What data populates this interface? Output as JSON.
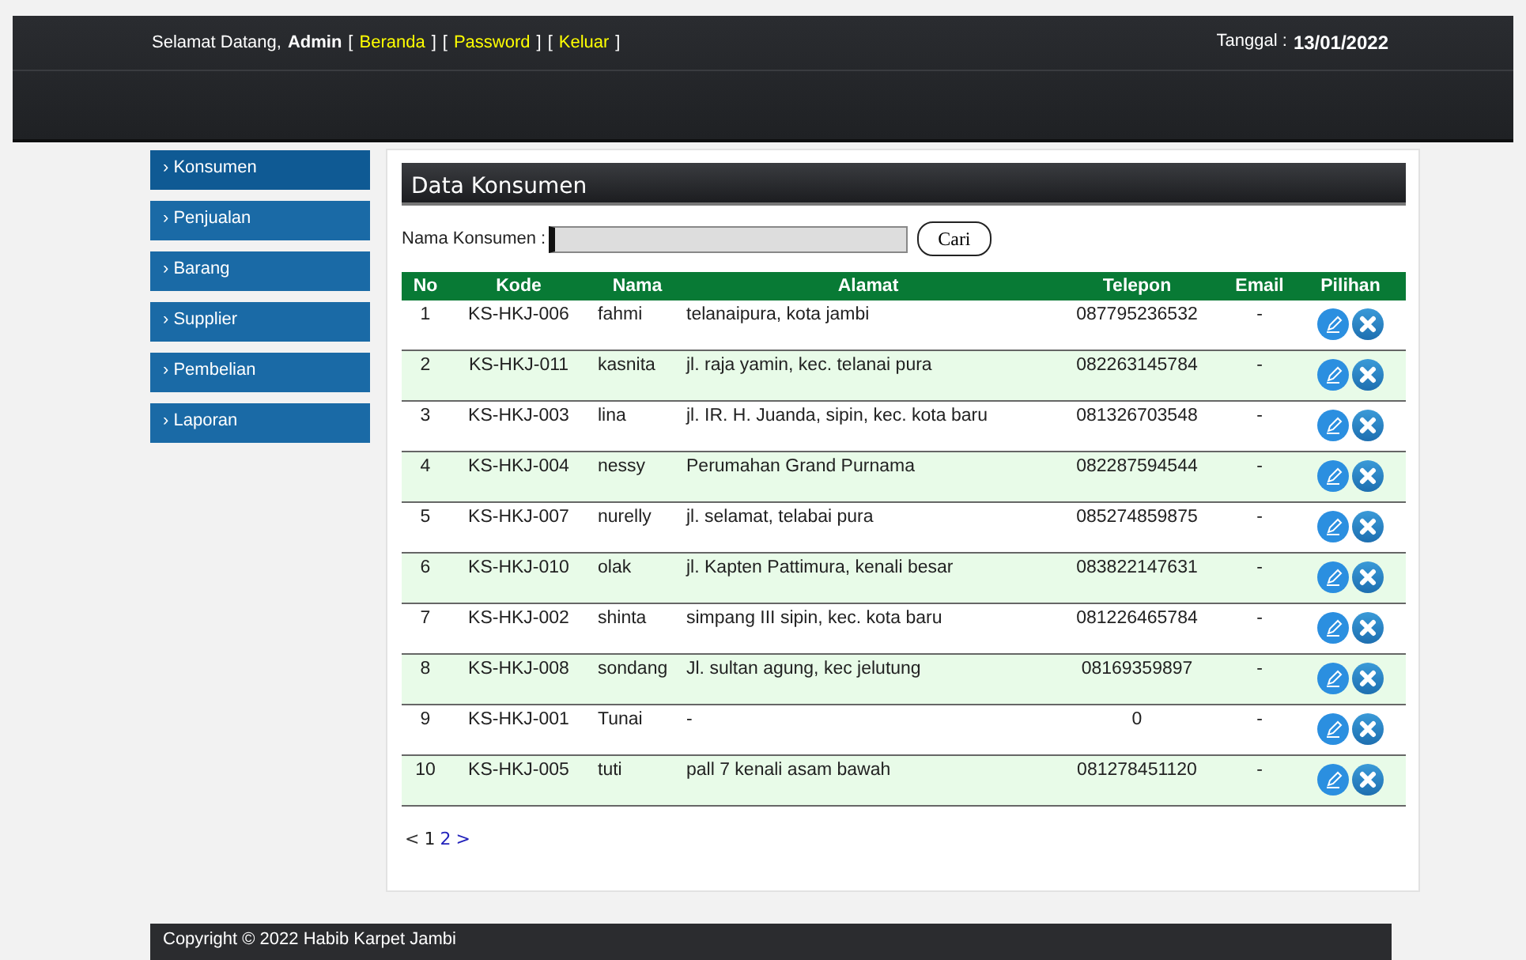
{
  "header": {
    "greeting": "Selamat Datang,",
    "user": "Admin",
    "nav": [
      {
        "kind": "bracket",
        "text": "["
      },
      {
        "kind": "link",
        "text": "Beranda"
      },
      {
        "kind": "bracket",
        "text": "]"
      },
      {
        "kind": "bracket",
        "text": "["
      },
      {
        "kind": "link",
        "text": "Password"
      },
      {
        "kind": "bracket",
        "text": "]"
      },
      {
        "kind": "bracket",
        "text": "["
      },
      {
        "kind": "link",
        "text": "Keluar"
      },
      {
        "kind": "bracket",
        "text": "]"
      }
    ],
    "date_label": "Tanggal :",
    "date": "13/01/2022"
  },
  "sidebar": {
    "items": [
      {
        "label": "› Konsumen",
        "selected": true
      },
      {
        "label": "› Penjualan",
        "selected": false
      },
      {
        "label": "› Barang",
        "selected": false
      },
      {
        "label": "› Supplier",
        "selected": false
      },
      {
        "label": "› Pembelian",
        "selected": false
      },
      {
        "label": "› Laporan",
        "selected": false
      }
    ]
  },
  "panel": {
    "title": "Data Konsumen",
    "search_label": "Nama Konsumen :",
    "search_button": "Cari"
  },
  "table": {
    "columns": [
      "No",
      "Kode",
      "Nama",
      "Alamat",
      "Telepon",
      "Email",
      "Pilihan"
    ],
    "rows": [
      [
        "1",
        "KS-HKJ-006",
        "fahmi",
        "telanaipura, kota jambi",
        "087795236532",
        "-"
      ],
      [
        "2",
        "KS-HKJ-011",
        "kasnita",
        "jl. raja yamin, kec. telanai pura",
        "082263145784",
        "-"
      ],
      [
        "3",
        "KS-HKJ-003",
        "lina",
        "jl. IR. H. Juanda, sipin, kec. kota baru",
        "081326703548",
        "-"
      ],
      [
        "4",
        "KS-HKJ-004",
        "nessy",
        "Perumahan Grand Purnama",
        "082287594544",
        "-"
      ],
      [
        "5",
        "KS-HKJ-007",
        "nurelly",
        "jl. selamat, telabai pura",
        "085274859875",
        "-"
      ],
      [
        "6",
        "KS-HKJ-010",
        "olak",
        "jl. Kapten Pattimura, kenali besar",
        "083822147631",
        "-"
      ],
      [
        "7",
        "KS-HKJ-002",
        "shinta",
        "simpang III sipin, kec. kota baru",
        "081226465784",
        "-"
      ],
      [
        "8",
        "KS-HKJ-008",
        "sondang",
        "Jl. sultan agung, kec jelutung",
        "08169359897",
        "-"
      ],
      [
        "9",
        "KS-HKJ-001",
        "Tunai",
        "-",
        "0",
        "-"
      ],
      [
        "10",
        "KS-HKJ-005",
        "tuti",
        "pall 7 kenali asam bawah",
        "081278451120",
        "-"
      ]
    ]
  },
  "pagination": [
    {
      "label": "<",
      "selected": false,
      "disabled": true
    },
    {
      "label": "1",
      "selected": true,
      "disabled": false
    },
    {
      "label": "2",
      "selected": false,
      "disabled": false
    },
    {
      "label": ">",
      "selected": false,
      "disabled": false
    }
  ],
  "footer": {
    "text": "Copyright © 2022 Habib Karpet Jambi"
  }
}
